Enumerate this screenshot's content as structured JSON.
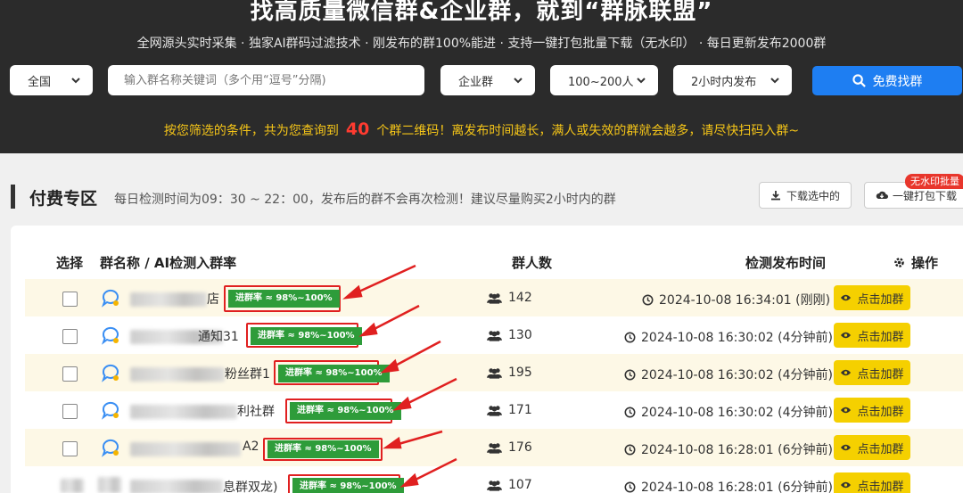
{
  "header": {
    "title": "找高质量微信群&企业群，就到“群脉联盟”",
    "subtitle": "全网源头实时采集 · 独家AI群码过滤技术 · 刚发布的群100%能进 · 支持一键打包批量下载（无水印） · 每日更新发布2000群"
  },
  "filters": {
    "region": "全国",
    "keyword_placeholder": "输入群名称关键词（多个用“逗号”分隔)",
    "type": "企业群",
    "size": "100~200人",
    "time": "2小时内发布",
    "search_label": "免费找群"
  },
  "notice": {
    "before": "按您筛选的条件，共为您查询到",
    "count": "40",
    "after": "个群二维码！离发布时间越长，满人或失效的群就会越多，请尽快扫码入群~"
  },
  "section": {
    "title": "付费专区",
    "desc": "每日检测时间为09：30 ~ 22：00，发布后的群不会再次检测！建议尽量购买2小时内的群",
    "download_selected": "下载选中的",
    "pack_download": "一键打包下载",
    "pack_badge": "无水印批量"
  },
  "table": {
    "headers": {
      "select": "选择",
      "name": "群名称 / AI检测入群率",
      "members": "群人数",
      "time": "检测发布时间",
      "action": "操作"
    },
    "rate_label": "进群率 ≈ 98%~100%",
    "join_label": "点击加群",
    "rows": [
      {
        "name_visible": "店",
        "name_mid": "逸",
        "members": "142",
        "time": "2024-10-08 16:34:01 (刚刚)"
      },
      {
        "name_visible": "通知31",
        "name_mid": "",
        "members": "130",
        "time": "2024-10-08 16:30:02 (4分钟前)"
      },
      {
        "name_visible": "粉丝群1",
        "name_mid": "",
        "members": "195",
        "time": "2024-10-08 16:30:02 (4分钟前)"
      },
      {
        "name_visible": "利社群",
        "name_mid": "",
        "members": "171",
        "time": "2024-10-08 16:30:02 (4分钟前)"
      },
      {
        "name_visible": "A2",
        "name_mid": "尊",
        "members": "176",
        "time": "2024-10-08 16:28:01 (6分钟前)"
      },
      {
        "name_visible": "息群双龙)",
        "name_mid": "",
        "members": "107",
        "time": "2024-10-08 16:28:01 (6分钟前)"
      }
    ]
  },
  "colors": {
    "header_bg": "#2b2b2b",
    "accent_blue": "#1e7ef2",
    "notice_yellow": "#f5c518",
    "count_red": "#ff3b30",
    "rate_green": "#2e9c3a",
    "join_yellow": "#f5d000",
    "highlight_red": "#e02020"
  },
  "icons": {
    "select_chevron": "chevron-down-icon",
    "search": "search-icon",
    "download": "download-icon",
    "cloud": "cloud-download-icon",
    "gear": "gear-icon",
    "members": "users-icon",
    "clock": "clock-icon",
    "eye": "eye-icon",
    "chat": "chat-bubble-icon"
  }
}
